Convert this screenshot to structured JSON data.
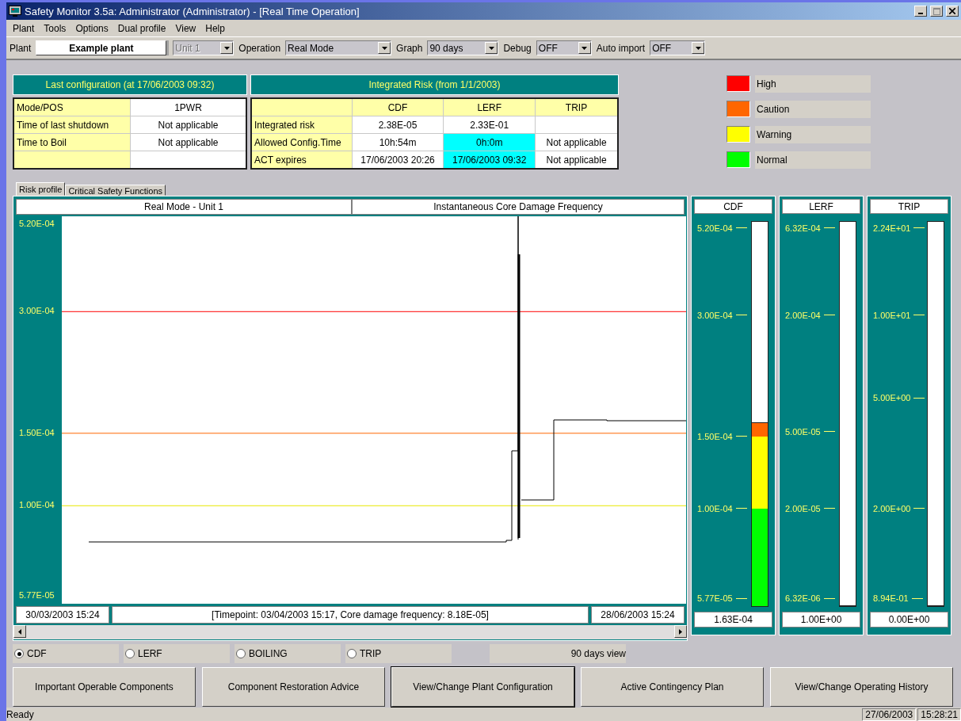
{
  "window": {
    "title": "Safety Monitor 3.5a: Administrator (Administrator) - [Real Time Operation]"
  },
  "menu": [
    "Plant",
    "Tools",
    "Options",
    "Dual profile",
    "View",
    "Help"
  ],
  "toolbar": {
    "plant_label": "Plant",
    "plant": "Example plant",
    "unit": {
      "value": "Unit 1",
      "disabled": true
    },
    "operation_label": "Operation",
    "operation": "Real Mode",
    "graph_label": "Graph",
    "graph": "90 days",
    "debug_label": "Debug",
    "debug": "OFF",
    "auto_import_label": "Auto import",
    "auto_import": "OFF"
  },
  "last_configuration": {
    "title": "Last configuration (at 17/06/2003 09:32)",
    "rows": [
      {
        "label": "Mode/POS",
        "value": "1PWR"
      },
      {
        "label": "Time of last shutdown",
        "value": "Not applicable"
      },
      {
        "label": "Time to Boil",
        "value": "Not applicable"
      }
    ]
  },
  "integrated_risk": {
    "title": "Integrated Risk (from 1/1/2003)",
    "columns": [
      "CDF",
      "LERF",
      "TRIP"
    ],
    "rows": [
      {
        "label": "Integrated risk",
        "cells": [
          {
            "text": "2.38E-05",
            "highlight": false
          },
          {
            "text": "2.33E-01",
            "highlight": false
          },
          {
            "highlight": false
          }
        ]
      },
      {
        "label": "Allowed Config.Time",
        "cells": [
          {
            "text": "10h:54m",
            "highlight": false
          },
          {
            "text": "0h:0m",
            "highlight": true
          },
          {
            "text": "Not applicable",
            "highlight": false
          }
        ]
      },
      {
        "label": "ACT expires",
        "cells": [
          {
            "text": "17/06/2003 20:26",
            "highlight": false
          },
          {
            "text": "17/06/2003 09:32",
            "highlight": true
          },
          {
            "text": "Not applicable",
            "highlight": false
          }
        ]
      }
    ]
  },
  "legend": [
    {
      "label": "High",
      "color": "#ff0000"
    },
    {
      "label": "Caution",
      "color": "#ff6600"
    },
    {
      "label": "Warning",
      "color": "#ffff00"
    },
    {
      "label": "Normal",
      "color": "#00ff00"
    }
  ],
  "tabs": [
    {
      "label": "Risk profile",
      "selected": true
    },
    {
      "label": "Critical Safety Functions",
      "selected": false
    }
  ],
  "risk_profile": {
    "mode_title": "Real Mode - Unit 1",
    "chart_title": "Instantaneous Core Damage Frequency",
    "y_labels": [
      "5.20E-04",
      "3.00E-04",
      "1.50E-04",
      "1.00E-04",
      "5.77E-05"
    ],
    "start": "30/03/2003 15:24",
    "timepoint": "[Timepoint: 03/04/2003 15:17, Core damage frequency: 8.18E-05]",
    "end": "28/06/2003 15:24"
  },
  "gauges": [
    {
      "title": "CDF",
      "ticks": [
        "5.20E-04",
        "3.00E-04",
        "1.50E-04",
        "1.00E-04",
        "5.77E-05"
      ],
      "level": 0.476,
      "reading": "1.63E-04"
    },
    {
      "title": "LERF",
      "ticks": [
        "6.32E-04",
        "2.00E-04",
        "5.00E-05",
        "2.00E-05",
        "6.32E-06"
      ],
      "level": 0,
      "reading": "1.00E+00"
    },
    {
      "title": "TRIP",
      "ticks": [
        "2.24E+01",
        "1.00E+01",
        "5.00E+00",
        "2.00E+00",
        "8.94E-01"
      ],
      "level": 0,
      "reading": "0.00E+00"
    }
  ],
  "radios": [
    {
      "label": "CDF",
      "selected": true
    },
    {
      "label": "LERF",
      "selected": false
    },
    {
      "label": "BOILING",
      "selected": false
    },
    {
      "label": "TRIP",
      "selected": false
    }
  ],
  "view_label": "90 days view",
  "buttons": [
    {
      "label": "Important Operable Components",
      "default": false
    },
    {
      "label": "Component Restoration Advice",
      "default": false
    },
    {
      "label": "View/Change Plant Configuration",
      "default": true
    },
    {
      "label": "Active Contingency Plan",
      "default": false
    },
    {
      "label": "View/Change Operating History",
      "default": false
    }
  ],
  "status_bar": {
    "text": "Ready",
    "date": "27/06/2003",
    "time": "15:28:21"
  }
}
